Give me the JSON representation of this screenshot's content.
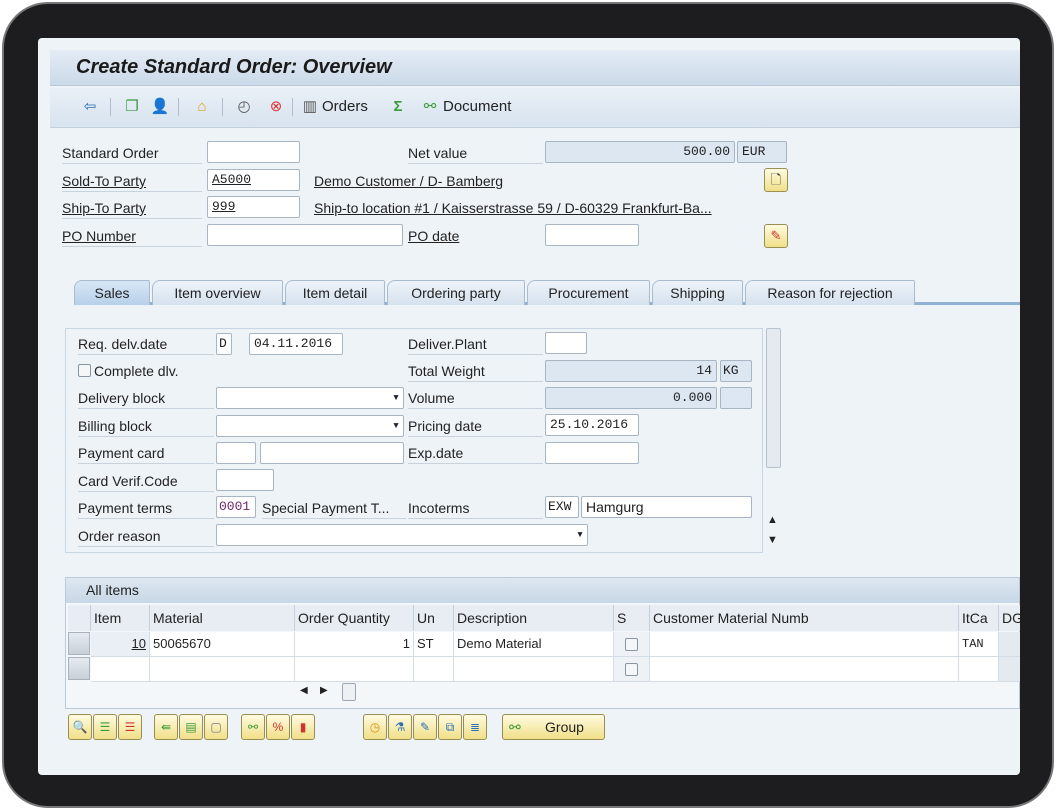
{
  "title": "Create Standard Order: Overview",
  "toolbar": {
    "orders_label": "Orders",
    "document_label": "Document",
    "icons": [
      "exit-icon",
      "copy-icon",
      "person-icon",
      "hierarchy-icon",
      "clock-icon",
      "cancel-icon",
      "orders-icon",
      "sum-icon",
      "document-flow-icon"
    ]
  },
  "header": {
    "standard_order_label": "Standard Order",
    "standard_order_value": "",
    "sold_to_label": "Sold-To Party",
    "sold_to_value": "A5000",
    "sold_to_desc": "Demo Customer / D- Bamberg",
    "ship_to_label": "Ship-To Party",
    "ship_to_value": "999",
    "ship_to_desc": "Ship-to location #1 / Kaisserstrasse 59 / D-60329 Frankfurt-Ba...",
    "po_number_label": "PO Number",
    "po_number_value": "",
    "net_value_label": "Net value",
    "net_value": "500.00",
    "currency": "EUR",
    "po_date_label": "PO date",
    "po_date_value": ""
  },
  "tabs": [
    "Sales",
    "Item overview",
    "Item detail",
    "Ordering party",
    "Procurement",
    "Shipping",
    "Reason for rejection"
  ],
  "active_tab": "Sales",
  "sales": {
    "req_deliv_label": "Req. delv.date",
    "req_deliv_type": "D",
    "req_deliv_date": "04.11.2016",
    "complete_dlv_label": "Complete dlv.",
    "complete_dlv_checked": false,
    "delivery_block_label": "Delivery block",
    "delivery_block_value": "",
    "billing_block_label": "Billing block",
    "billing_block_value": "",
    "payment_card_label": "Payment card",
    "card_verif_label": "Card Verif.Code",
    "payment_terms_label": "Payment terms",
    "payment_terms_code": "0001",
    "payment_terms_desc": "Special Payment T...",
    "order_reason_label": "Order reason",
    "order_reason_value": "",
    "deliver_plant_label": "Deliver.Plant",
    "deliver_plant_value": "",
    "total_weight_label": "Total Weight",
    "total_weight": "14",
    "weight_unit": "KG",
    "volume_label": "Volume",
    "volume": "0.000",
    "volume_unit": "",
    "pricing_date_label": "Pricing date",
    "pricing_date": "25.10.2016",
    "exp_date_label": "Exp.date",
    "exp_date": "",
    "incoterms_label": "Incoterms",
    "incoterms_code": "EXW",
    "incoterms_place": "Hamgurg"
  },
  "items": {
    "title": "All items",
    "columns": [
      "Item",
      "Material",
      "Order Quantity",
      "Un",
      "Description",
      "S",
      "Customer Material Numb",
      "ItCa",
      "DG"
    ],
    "rows": [
      {
        "item": "10",
        "material": "50065670",
        "qty": "1",
        "unit": "ST",
        "description": "Demo Material",
        "s": false,
        "cust_mat": "",
        "itca": "TAN"
      },
      {
        "item": "",
        "material": "",
        "qty": "",
        "unit": "",
        "description": "",
        "s": false,
        "cust_mat": "",
        "itca": ""
      }
    ]
  },
  "bottom": {
    "group_label": "Group"
  }
}
